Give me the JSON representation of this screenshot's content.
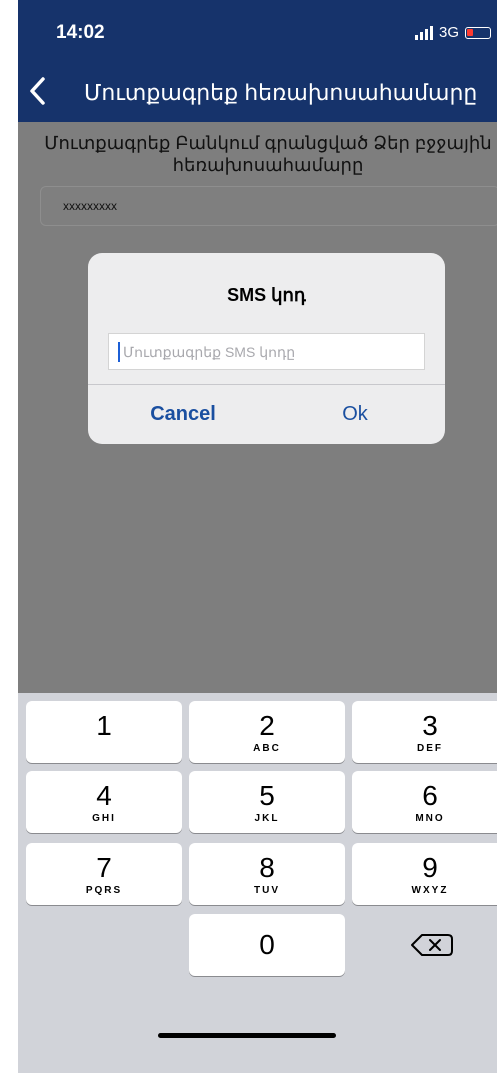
{
  "status": {
    "time": "14:02",
    "network": "3G"
  },
  "nav": {
    "title": "Մուտքագրեք հեռախոսահամարը"
  },
  "content": {
    "instruction": "Մուտքագրեք Բանկում գրանցված Ձեր բջջային հեռախոսահամարը",
    "phone_value": "xxxxxxxxx"
  },
  "dialog": {
    "title": "SMS կոդ",
    "placeholder": "Մուտքագրեք SMS կոդը",
    "cancel_label": "Cancel",
    "ok_label": "Ok"
  },
  "keyboard": {
    "keys": [
      {
        "num": "1",
        "letters": ""
      },
      {
        "num": "2",
        "letters": "ABC"
      },
      {
        "num": "3",
        "letters": "DEF"
      },
      {
        "num": "4",
        "letters": "GHI"
      },
      {
        "num": "5",
        "letters": "JKL"
      },
      {
        "num": "6",
        "letters": "MNO"
      },
      {
        "num": "7",
        "letters": "PQRS"
      },
      {
        "num": "8",
        "letters": "TUV"
      },
      {
        "num": "9",
        "letters": "WXYZ"
      },
      {
        "num": "0",
        "letters": ""
      }
    ]
  },
  "colors": {
    "nav_bg": "#16336b",
    "accent": "#1a4fa0",
    "battery": "#ff3b30"
  }
}
